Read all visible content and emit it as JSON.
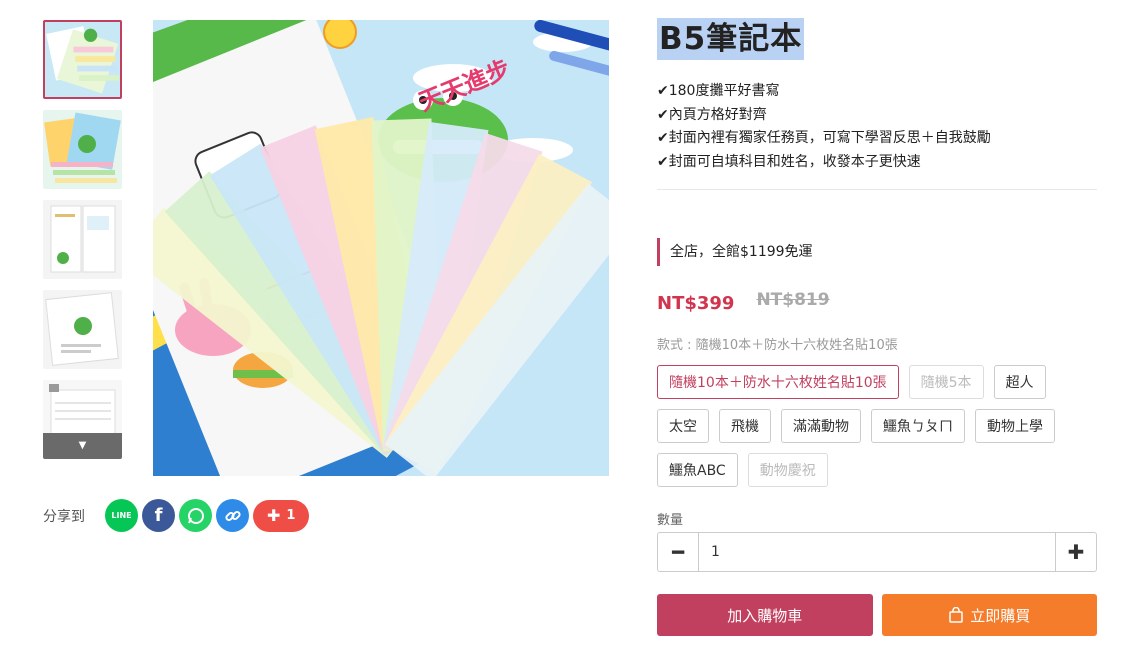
{
  "product": {
    "title": "B5筆記本",
    "features": [
      "✔180度攤平好書寫",
      "✔內頁方格好對齊",
      "✔封面內裡有獨家任務頁，可寫下學習反思＋自我鼓勵",
      "✔封面可自填科目和姓名，收發本子更快速"
    ],
    "promo": "全店，全館$1199免運",
    "price": "NT$399",
    "original_price": "NT$819",
    "image_text": "天天進步"
  },
  "variant": {
    "label": "款式 : 隨機10本＋防水十六枚姓名貼10張",
    "options": [
      {
        "label": "隨機10本＋防水十六枚姓名貼10張",
        "state": "selected"
      },
      {
        "label": "隨機5本",
        "state": "disabled"
      },
      {
        "label": "超人",
        "state": "normal"
      },
      {
        "label": "太空",
        "state": "normal"
      },
      {
        "label": "飛機",
        "state": "normal"
      },
      {
        "label": "滿滿動物",
        "state": "normal"
      },
      {
        "label": "鱷魚ㄅㄆㄇ",
        "state": "normal"
      },
      {
        "label": "動物上學",
        "state": "normal"
      },
      {
        "label": "鱷魚ABC",
        "state": "normal"
      },
      {
        "label": "動物慶祝",
        "state": "disabled"
      }
    ]
  },
  "quantity": {
    "label": "數量",
    "value": "1"
  },
  "actions": {
    "add_to_cart": "加入購物車",
    "buy_now": "立即購買"
  },
  "share": {
    "label": "分享到",
    "line_text": "LINE",
    "plus_count": "1"
  },
  "colors": {
    "accent": "#c2405f",
    "buy": "#f47c2a",
    "line": "#06c755",
    "facebook": "#3b5998",
    "whatsapp": "#25d366",
    "link": "#2e8ce8",
    "plus": "#ef4e47"
  },
  "icons": [
    "chevron-down-icon",
    "line-icon",
    "facebook-icon",
    "whatsapp-icon",
    "link-icon",
    "plus-icon",
    "minus-icon",
    "shopping-bag-icon"
  ]
}
